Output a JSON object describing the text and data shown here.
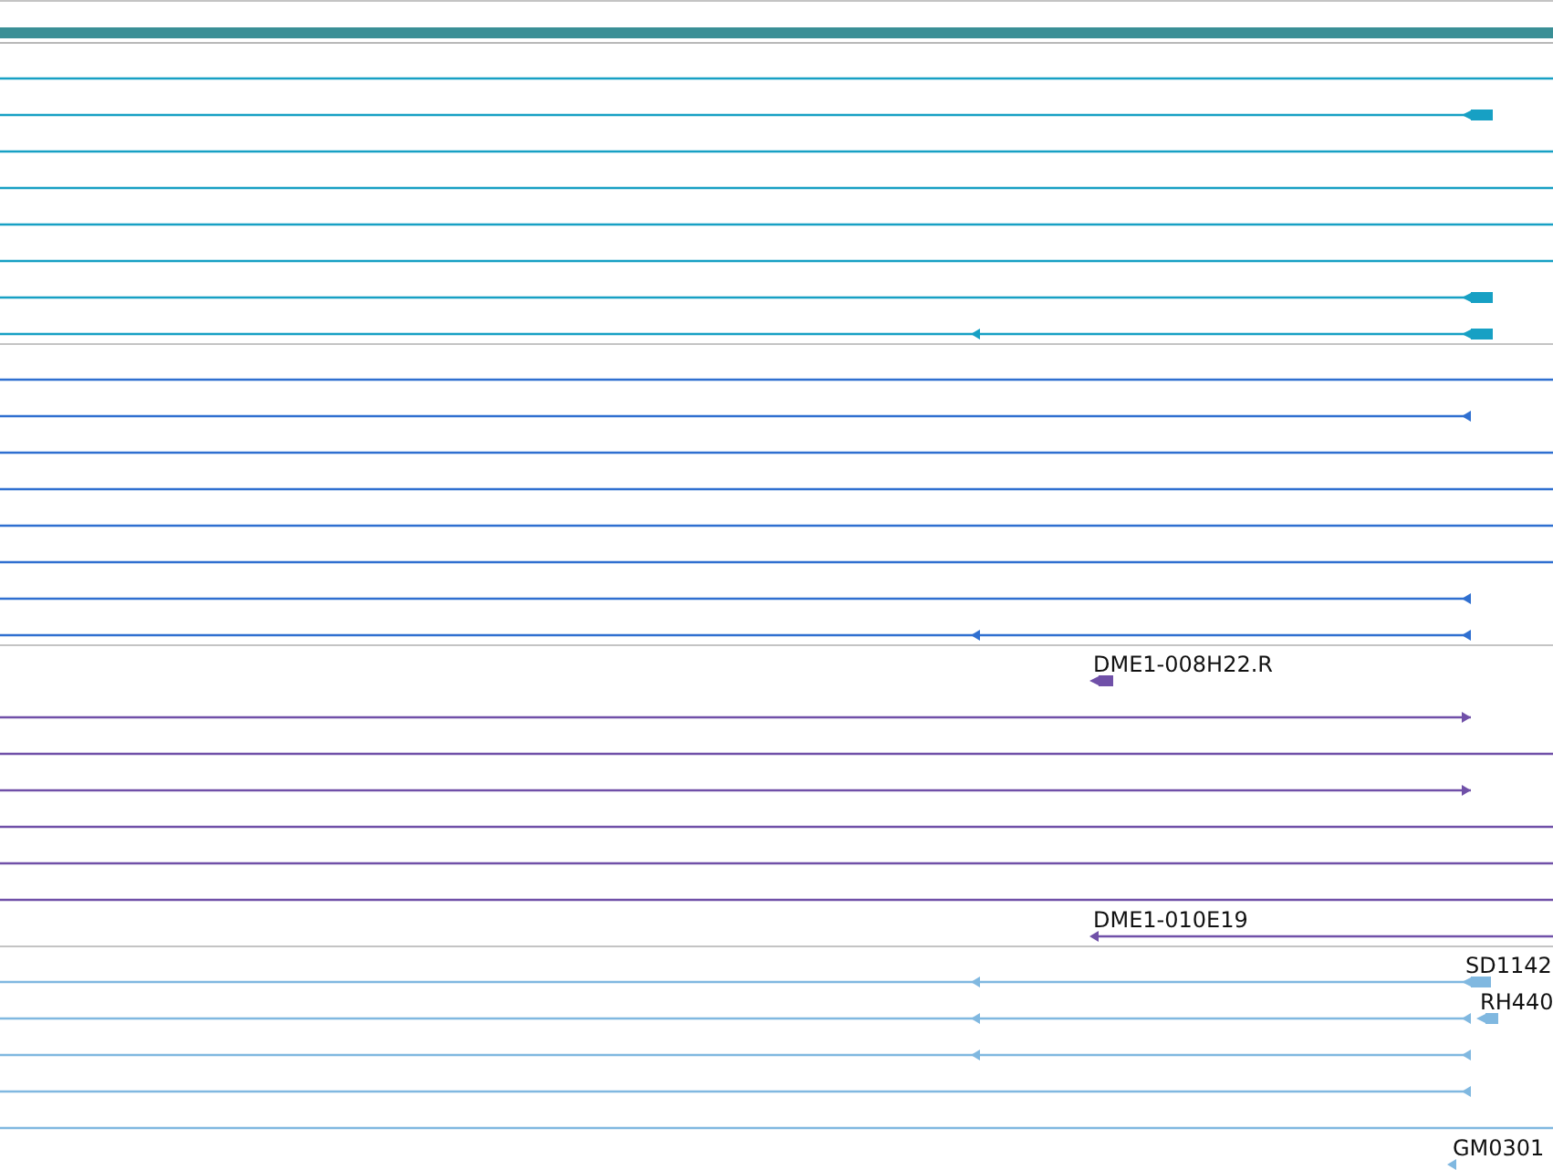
{
  "tracks": [
    {
      "color": "#17a0c4",
      "rows": [
        {
          "kind": "plain"
        },
        {
          "kind": "reverse"
        },
        {
          "kind": "plain"
        },
        {
          "kind": "plain"
        },
        {
          "kind": "plain"
        },
        {
          "kind": "plain"
        },
        {
          "kind": "reverse"
        },
        {
          "kind": "reverse"
        }
      ]
    },
    {
      "color": "#2f6fd0",
      "rows": [
        {
          "kind": "plain"
        },
        {
          "kind": "reverse"
        },
        {
          "kind": "plain"
        },
        {
          "kind": "plain"
        },
        {
          "kind": "plain"
        },
        {
          "kind": "plain"
        },
        {
          "kind": "reverse"
        },
        {
          "kind": "reverse"
        }
      ]
    },
    {
      "color": "#7050a8",
      "rows": [
        {
          "kind": "reverse",
          "label": "DME1-008H22.R"
        },
        {
          "kind": "forward"
        },
        {
          "kind": "plain"
        },
        {
          "kind": "forward"
        },
        {
          "kind": "plain"
        },
        {
          "kind": "plain"
        },
        {
          "kind": "plain"
        },
        {
          "kind": "reverse",
          "label": "DME1-010E19"
        }
      ]
    },
    {
      "color": "#80b8e0",
      "rows": [
        {
          "kind": "reverse",
          "label": "SD1142"
        },
        {
          "kind": "reverse",
          "label": "RH440"
        },
        {
          "kind": "reverse"
        },
        {
          "kind": "reverse"
        },
        {
          "kind": "plain"
        },
        {
          "kind": "reverse",
          "label": "GM0301"
        }
      ]
    }
  ]
}
